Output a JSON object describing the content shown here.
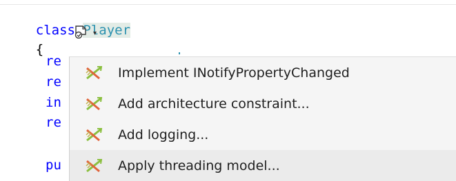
{
  "code": {
    "class_keyword": "class",
    "class_name": "Player",
    "open_brace": "{",
    "fragments": [
      "re",
      "re",
      "in",
      "re",
      "pu"
    ]
  },
  "smart_tag": {
    "icon": "smart-tag-refactor-icon",
    "chevron": "▾"
  },
  "menu": {
    "items": [
      {
        "label": "Implement INotifyPropertyChanged",
        "icon": "postsharp-crossed-arrows-icon"
      },
      {
        "label": "Add architecture constraint...",
        "icon": "postsharp-crossed-arrows-icon"
      },
      {
        "label": "Add logging...",
        "icon": "postsharp-crossed-arrows-icon"
      },
      {
        "label": "Apply threading model...",
        "icon": "postsharp-crossed-arrows-icon",
        "selected": true
      }
    ]
  },
  "colors": {
    "keyword": "#0000ff",
    "type": "#2b91af",
    "menu_bg": "#f5f5f5"
  }
}
